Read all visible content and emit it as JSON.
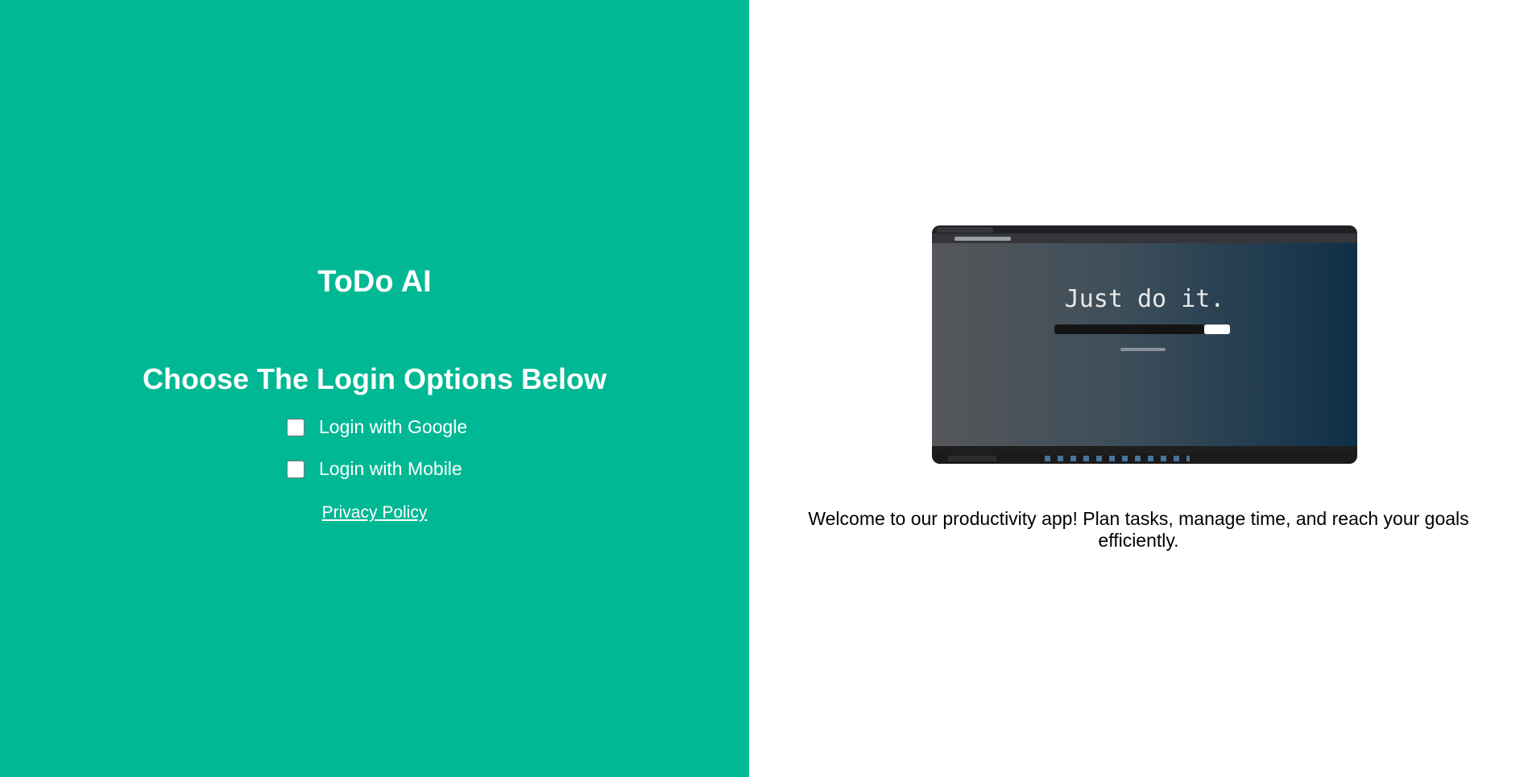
{
  "app": {
    "title": "ToDo AI"
  },
  "login": {
    "heading": "Choose The Login Options Below",
    "options": [
      {
        "label": "Login with Google",
        "checked": false
      },
      {
        "label": "Login with Mobile",
        "checked": false
      }
    ],
    "privacy_link": "Privacy Policy"
  },
  "preview": {
    "headline": "Just do it."
  },
  "welcome": {
    "text": "Welcome to our productivity app! Plan tasks, manage time, and reach your goals efficiently."
  },
  "colors": {
    "brand_green": "#00b894",
    "text_on_brand": "#ffffff",
    "body_text": "#000000"
  },
  "icons": [
    "checkbox-icon"
  ]
}
